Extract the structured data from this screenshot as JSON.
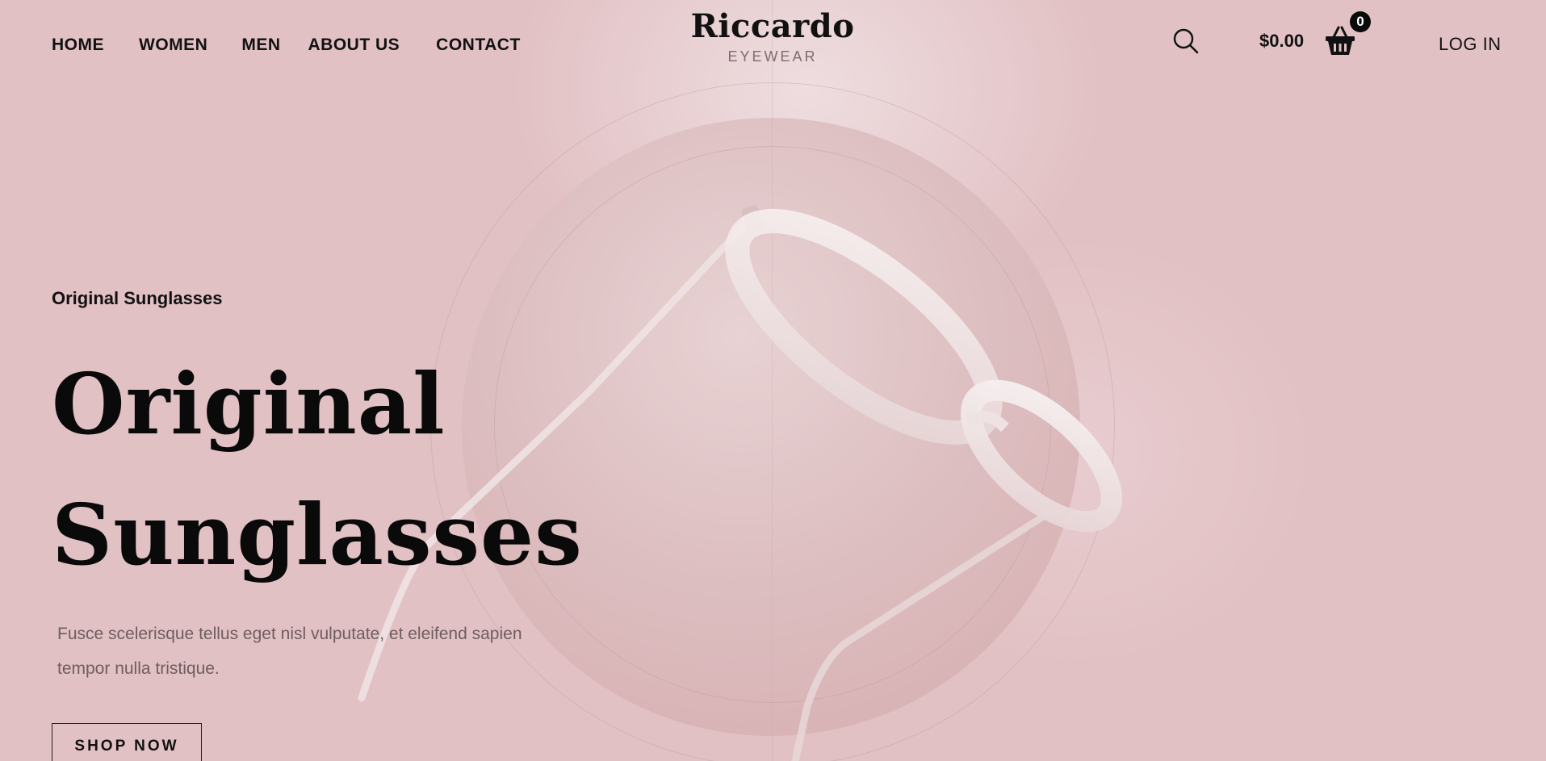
{
  "header": {
    "nav": [
      "HOME",
      "WOMEN",
      "MEN",
      "ABOUT US",
      "CONTACT"
    ],
    "logo": {
      "name": "Riccardo",
      "tagline": "EYEWEAR"
    },
    "cart_total": "$0.00",
    "cart_count": "0",
    "login_label": "LOG IN",
    "icons": {
      "search": "search-icon",
      "cart": "basket-icon"
    }
  },
  "hero": {
    "eyebrow": "Original Sunglasses",
    "headline_line1": "Original",
    "headline_line2": "Sunglasses",
    "description": "Fusce scelerisque tellus eget nisl vulputate, et eleifend sapien tempor nulla tristique.",
    "cta_label": "SHOP NOW"
  },
  "colors": {
    "background": "#e2c1c4",
    "disc": "#d5aaad",
    "text": "#0a0a0a",
    "muted_text": "#6e5d60"
  }
}
